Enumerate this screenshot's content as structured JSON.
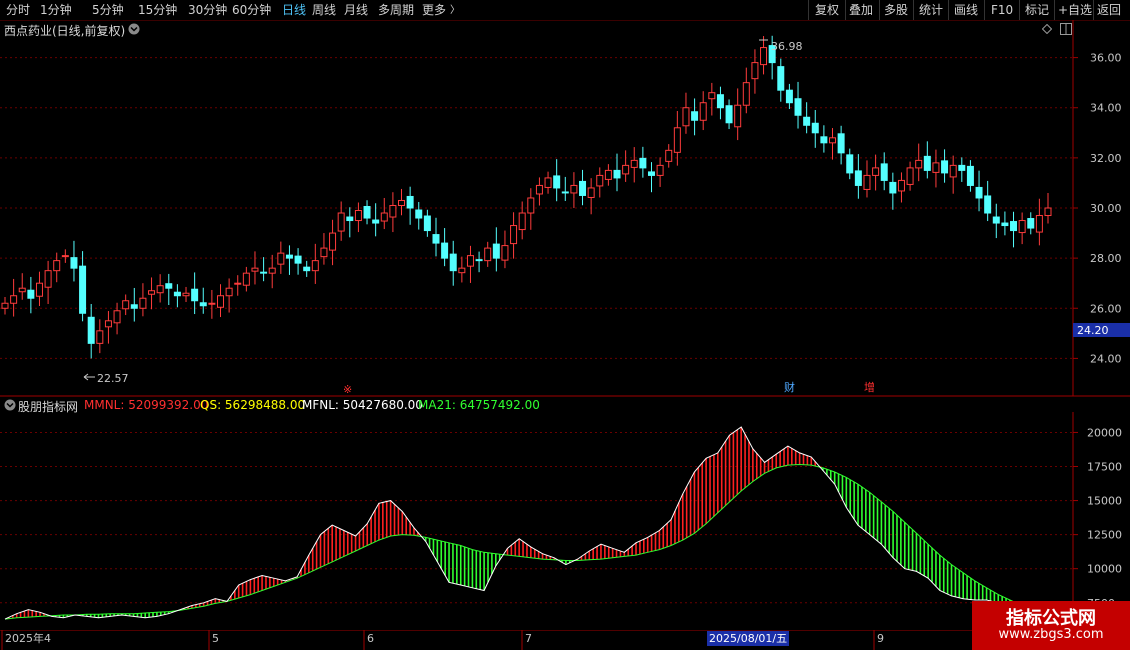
{
  "toolbar": {
    "periods": [
      "分时",
      "1分钟",
      "5分钟",
      "15分钟",
      "30分钟",
      "60分钟",
      "日线",
      "周线",
      "月线",
      "多周期",
      "更多"
    ],
    "active_period": "日线",
    "more_arrow": "〉",
    "right_buttons": [
      "复权",
      "叠加",
      "多股",
      "统计",
      "画线",
      "F10",
      "标记",
      "+自选",
      "返回"
    ]
  },
  "main_pane": {
    "title": "西点药业(日线,前复权)",
    "title_icon": "chevron-down-icon",
    "right_icons": [
      "diamond-icon",
      "panel-toggle-icon"
    ],
    "price_ticks": [
      "36.00",
      "34.00",
      "32.00",
      "30.00",
      "28.00",
      "26.00",
      "24.00"
    ],
    "current_price_label": "24.20",
    "high_label": "36.98",
    "low_label": "22.57",
    "markers": [
      {
        "text": "※",
        "color": "#ff3030"
      },
      {
        "text": "财",
        "color": "#4fa8ff"
      },
      {
        "text": "增",
        "color": "#ff3030"
      }
    ]
  },
  "indicator_pane": {
    "name": "股朋指标网",
    "items": [
      {
        "label": "MMNL: 52099392.00",
        "color": "#ff3030"
      },
      {
        "label": "QS: 56298488.00",
        "color": "#ffff00"
      },
      {
        "label": "MFNL: 50427680.00",
        "color": "#ffffff"
      },
      {
        "label": "MA21: 64757492.00",
        "color": "#30ff30"
      }
    ],
    "ticks": [
      "20000",
      "17500",
      "15000",
      "12500",
      "10000",
      "7500"
    ]
  },
  "date_axis": {
    "labels": [
      "2025年4",
      "5",
      "6",
      "7",
      "2025/08/01/五",
      "9"
    ]
  },
  "watermark": {
    "title": "指标公式网",
    "url": "www.zbgs3.com"
  },
  "chart_data": [
    {
      "type": "candlestick",
      "title": "西点药业(日线,前复权)",
      "ylim": [
        22.5,
        37.5
      ],
      "high": 36.98,
      "low": 22.57,
      "closes": [
        26.2,
        26.5,
        26.8,
        26.4,
        27.0,
        27.5,
        27.9,
        28.1,
        27.6,
        25.8,
        24.6,
        25.1,
        25.5,
        25.9,
        26.3,
        26.0,
        26.4,
        26.7,
        26.9,
        26.8,
        26.5,
        26.6,
        26.3,
        26.1,
        26.2,
        26.5,
        26.8,
        27.0,
        27.4,
        27.6,
        27.4,
        27.6,
        28.2,
        28.0,
        27.8,
        27.5,
        27.9,
        28.4,
        29.0,
        29.8,
        29.5,
        29.9,
        29.6,
        29.4,
        29.8,
        30.1,
        30.3,
        30.0,
        29.6,
        29.1,
        28.6,
        28.0,
        27.5,
        27.6,
        28.1,
        27.9,
        28.4,
        28.0,
        28.5,
        29.3,
        29.8,
        30.4,
        30.9,
        31.2,
        30.8,
        30.6,
        30.9,
        30.5,
        30.8,
        31.3,
        31.5,
        31.2,
        31.7,
        31.9,
        31.6,
        31.3,
        31.7,
        32.3,
        33.2,
        34.0,
        33.5,
        34.2,
        34.6,
        34.0,
        33.4,
        34.1,
        35.0,
        35.8,
        36.4,
        35.8,
        34.7,
        34.2,
        33.7,
        33.3,
        33.0,
        32.6,
        32.8,
        32.2,
        31.4,
        30.9,
        31.3,
        31.6,
        31.1,
        30.6,
        31.1,
        31.6,
        31.9,
        31.5,
        31.8,
        31.4,
        31.7,
        31.5,
        30.9,
        30.4,
        29.8,
        29.4,
        29.3,
        29.1,
        29.5,
        29.2,
        29.7,
        30.0
      ]
    },
    {
      "type": "line",
      "title": "股朋指标网",
      "ylim": [
        5500,
        21500
      ],
      "series": [
        {
          "name": "MMNL",
          "color": "#ff3030",
          "values": [
            6300,
            6700,
            7000,
            6800,
            6500,
            6400,
            6600,
            6500,
            6400,
            6500,
            6600,
            6500,
            6400,
            6500,
            6700,
            7000,
            7300,
            7500,
            7800,
            7600,
            8800,
            9200,
            9500,
            9300,
            9100,
            9400,
            11000,
            12500,
            13200,
            12800,
            12400,
            13300,
            14800,
            15000,
            14200,
            13000,
            12000,
            10500,
            9000,
            8800,
            8600,
            8400,
            10200,
            11500,
            12200,
            11600,
            11100,
            10800,
            10300,
            10700,
            11300,
            11800,
            11500,
            11200,
            11900,
            12300,
            12800,
            13600,
            15500,
            17100,
            18100,
            18500,
            19800,
            20400,
            18800,
            17800,
            18400,
            19000,
            18500,
            18200,
            17200,
            16200,
            14500,
            13200,
            12500,
            11800,
            10800,
            10000,
            9800,
            9300,
            8400,
            8000,
            7800,
            7700,
            7700,
            7500,
            7300,
            7100,
            6900,
            6800
          ]
        },
        {
          "name": "MA21",
          "color": "#30ff30",
          "values": [
            6300,
            6400,
            6450,
            6500,
            6550,
            6600,
            6600,
            6650,
            6650,
            6700,
            6700,
            6700,
            6750,
            6800,
            6850,
            6950,
            7100,
            7250,
            7450,
            7600,
            7850,
            8100,
            8400,
            8700,
            9000,
            9300,
            9700,
            10100,
            10500,
            10900,
            11300,
            11700,
            12100,
            12400,
            12500,
            12450,
            12300,
            12100,
            11900,
            11700,
            11400,
            11200,
            11100,
            11000,
            10900,
            10800,
            10700,
            10650,
            10600,
            10600,
            10650,
            10700,
            10800,
            10900,
            11000,
            11200,
            11400,
            11700,
            12100,
            12600,
            13300,
            14100,
            14900,
            15700,
            16400,
            17000,
            17400,
            17600,
            17650,
            17600,
            17400,
            17100,
            16700,
            16200,
            15600,
            14900,
            14200,
            13400,
            12600,
            11800,
            11000,
            10300,
            9700,
            9100,
            8600,
            8100,
            7700,
            7300,
            7000,
            6800
          ]
        }
      ]
    }
  ]
}
